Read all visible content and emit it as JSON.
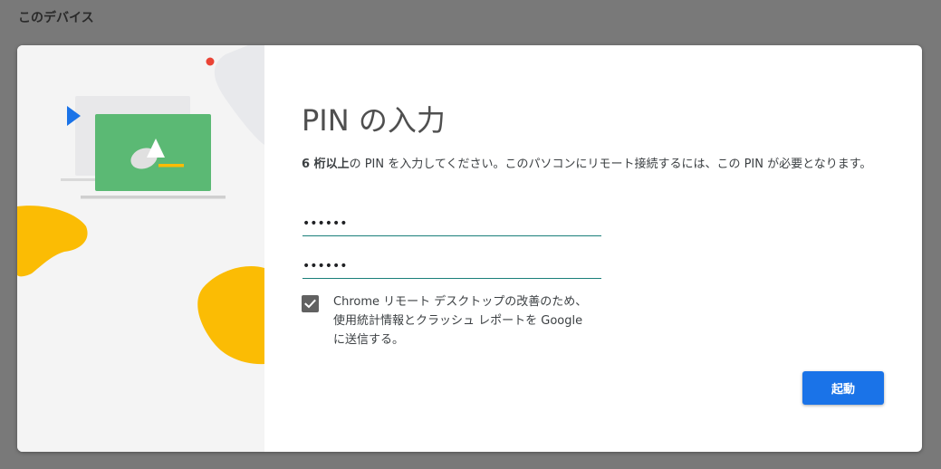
{
  "background": {
    "title": "このデバイス"
  },
  "dialog": {
    "heading": "PIN の入力",
    "description_bold": "6 桁以上",
    "description_rest": "の PIN を入力してください。このパソコンにリモート接続するには、この PIN が必要となります。",
    "pin_value": "••••••",
    "pin_confirm_value": "••••••",
    "checkbox_checked": true,
    "checkbox_label": "Chrome リモート デスクトップの改善のため、使用統計情報とクラッシュ レポートを Google に送信する。",
    "start_button": "起動"
  },
  "colors": {
    "accent": "#1a73e8",
    "underline": "#1a7f7a",
    "illustration_green": "#5bb974",
    "illustration_yellow": "#fbbc04",
    "illustration_blue": "#1a73e8",
    "illustration_red": "#ea4335"
  }
}
